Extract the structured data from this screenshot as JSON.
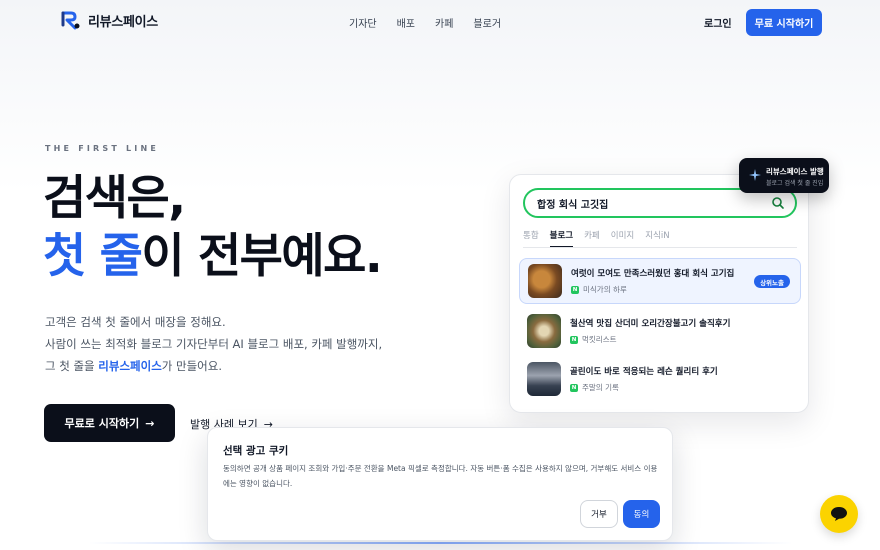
{
  "header": {
    "brand": "리뷰스페이스",
    "nav": [
      "기자단",
      "배포",
      "카페",
      "블로거"
    ],
    "login": "로그인",
    "start": "무료 시작하기"
  },
  "hero": {
    "eyebrow": "THE FIRST LINE",
    "headline_line1": "검색은,",
    "headline_accent": "첫 줄",
    "headline_rest": "이 전부예요.",
    "desc_line1": "고객은 검색 첫 줄에서 매장을 정해요.",
    "desc_line2": "사람이 쓰는 최적화 블로그 기자단부터 AI 블로그 배포, 카페 발행까지,",
    "desc_line3_prefix": "그 첫 줄을 ",
    "desc_line3_brand": "리뷰스페이스",
    "desc_line3_suffix": "가 만들어요.",
    "cta_primary": "무료로 시작하기",
    "cta_secondary": "발행 사례 보기",
    "arrow": "→"
  },
  "mockup": {
    "query": "합정 회식 고깃집",
    "tabs": [
      "통합",
      "블로그",
      "카페",
      "이미지",
      "지식iN"
    ],
    "active_tab": "블로그",
    "results": [
      {
        "title": "여럿이 모여도 만족스러웠던 홍대 회식 고기집",
        "author": "미식가의 하루",
        "badge": "상위노출"
      },
      {
        "title": "철산역 맛집 산더미 오리간장불고기 솔직후기",
        "author": "먹킷리스트",
        "badge": ""
      },
      {
        "title": "골린이도 바로 적응되는 레슨 퀄리티 후기",
        "author": "주말의 기록",
        "badge": ""
      }
    ],
    "naver_letter": "N",
    "float_title": "리뷰스페이스 발행",
    "float_sub": "블로그 검색 첫 줄 진입"
  },
  "cookie": {
    "title": "선택 광고 쿠키",
    "text": "동의하면 공개 상품 페이지 조회와 가입·주문 전환을 Meta 픽셀로 측정합니다. 자동 버튼·폼 수집은 사용하지 않으며, 거부해도 서비스 이용에는 영향이 없습니다.",
    "reject": "거부",
    "agree": "동의"
  },
  "icons": {
    "logo": "logo-icon",
    "search": "search-icon",
    "sparkle": "sparkle-icon",
    "chat": "chat-bubble-icon",
    "arrow": "arrow-right-icon"
  },
  "colors": {
    "accent": "#2563eb",
    "dark": "#0b0f1a",
    "search_border": "#22c55e",
    "chat": "#fbd300"
  }
}
